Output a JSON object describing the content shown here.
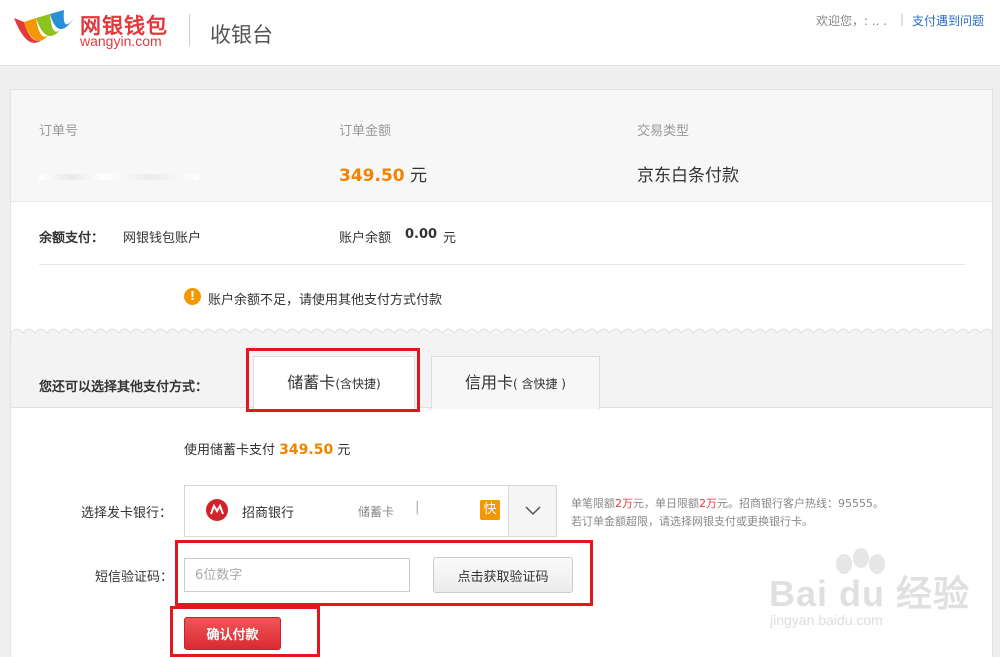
{
  "header": {
    "brand_cn": "网银钱包",
    "brand_en": "wangyin.com",
    "cashier": "收银台",
    "welcome": "欢迎您，: .. .",
    "separator": "|",
    "help": "支付遇到问题"
  },
  "order": {
    "number_label": "订单号",
    "amount_label": "订单金额",
    "amount_value": "349.50",
    "amount_unit": "元",
    "type_label": "交易类型",
    "type_value": "京东白条付款"
  },
  "balance": {
    "label": "余额支付：",
    "account": "网银钱包账户",
    "balance_label": "账户余额",
    "balance_value": "0.00",
    "balance_unit": "元",
    "warning": "账户余额不足，请使用其他支付方式付款",
    "warning_icon": "!"
  },
  "methods": {
    "label": "您还可以选择其他支付方式：",
    "tabs": [
      {
        "main": "储蓄卡",
        "sub": "(含快捷)"
      },
      {
        "main": "信用卡",
        "sub": "( 含快捷 )"
      }
    ]
  },
  "payment": {
    "use_prefix": "使用储蓄卡支付",
    "use_amount": "349.50",
    "use_unit": "元",
    "bank_label": "选择发卡银行：",
    "bank_name": "招商银行",
    "bank_type": "储蓄卡",
    "bank_sep": "|",
    "quick_badge": "快",
    "limit_line1": {
      "a": "单笔限额",
      "b": "2万",
      "c": "元，单日限额",
      "d": "2万",
      "e": "元。招商银行客户热线：95555。"
    },
    "limit_line2": "若订单金额超限，请选择网银支付或更换银行卡。",
    "sms_label": "短信验证码：",
    "sms_placeholder": "6位数字",
    "sms_button": "点击获取验证码",
    "confirm_button": "确认付款"
  },
  "watermark": {
    "text": "Bai du 经验",
    "url": "jingyan.baidu.com"
  },
  "colors": {
    "brand_red": "#e4393c",
    "amount_orange": "#f08300",
    "annotation_red": "#e3161d"
  }
}
